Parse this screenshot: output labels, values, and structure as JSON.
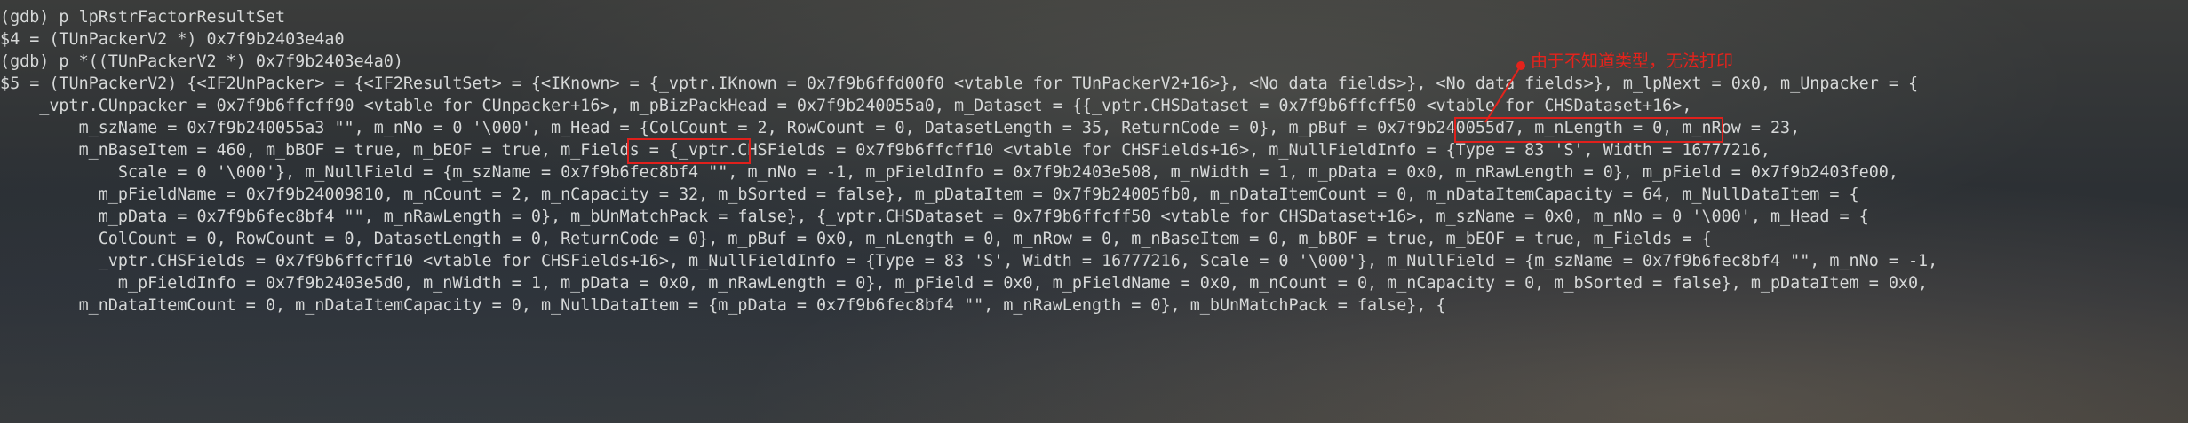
{
  "terminal": {
    "lines": [
      "(gdb) p lpRstrFactorResultSet",
      "$4 = (TUnPackerV2 *) 0x7f9b2403e4a0",
      "(gdb) p *((TUnPackerV2 *) 0x7f9b2403e4a0)",
      "$5 = (TUnPackerV2) {<IF2UnPacker> = {<IF2ResultSet> = {<IKnown> = {_vptr.IKnown = 0x7f9b6ffd00f0 <vtable for TUnPackerV2+16>}, <No data fields>}, <No data fields>}, m_lpNext = 0x0, m_Unpacker = {",
      "    _vptr.CUnpacker = 0x7f9b6ffcff90 <vtable for CUnpacker+16>, m_pBizPackHead = 0x7f9b240055a0, m_Dataset = {{_vptr.CHSDataset = 0x7f9b6ffcff50 <vtable for CHSDataset+16>,",
      "        m_szName = 0x7f9b240055a3 \"\", m_nNo = 0 '\\000', m_Head = {ColCount = 2, RowCount = 0, DatasetLength = 35, ReturnCode = 0}, m_pBuf = 0x7f9b240055d7, m_nLength = 0, m_nRow = 23,",
      "        m_nBaseItem = 460, m_bBOF = true, m_bEOF = true, m_Fields = {_vptr.CHSFields = 0x7f9b6ffcff10 <vtable for CHSFields+16>, m_NullFieldInfo = {Type = 83 'S', Width = 16777216,",
      "            Scale = 0 '\\000'}, m_NullField = {m_szName = 0x7f9b6fec8bf4 \"\", m_nNo = -1, m_pFieldInfo = 0x7f9b2403e508, m_nWidth = 1, m_pData = 0x0, m_nRawLength = 0}, m_pField = 0x7f9b2403fe00,",
      "          m_pFieldName = 0x7f9b24009810, m_nCount = 2, m_nCapacity = 32, m_bSorted = false}, m_pDataItem = 0x7f9b24005fb0, m_nDataItemCount = 0, m_nDataItemCapacity = 64, m_NullDataItem = {",
      "          m_pData = 0x7f9b6fec8bf4 \"\", m_nRawLength = 0}, m_bUnMatchPack = false}, {_vptr.CHSDataset = 0x7f9b6ffcff50 <vtable for CHSDataset+16>, m_szName = 0x0, m_nNo = 0 '\\000', m_Head = {",
      "          ColCount = 0, RowCount = 0, DatasetLength = 0, ReturnCode = 0}, m_pBuf = 0x0, m_nLength = 0, m_nRow = 0, m_nBaseItem = 0, m_bBOF = true, m_bEOF = true, m_Fields = {",
      "          _vptr.CHSFields = 0x7f9b6ffcff10 <vtable for CHSFields+16>, m_NullFieldInfo = {Type = 83 'S', Width = 16777216, Scale = 0 '\\000'}, m_NullField = {m_szName = 0x7f9b6fec8bf4 \"\", m_nNo = -1,",
      "            m_pFieldInfo = 0x7f9b2403e5d0, m_nWidth = 1, m_pData = 0x0, m_nRawLength = 0}, m_pField = 0x0, m_pFieldName = 0x0, m_nCount = 0, m_nCapacity = 0, m_bSorted = false}, m_pDataItem = 0x0,",
      "        m_nDataItemCount = 0, m_nDataItemCapacity = 0, m_NullDataItem = {m_pData = 0x7f9b6fec8bf4 \"\", m_nRawLength = 0}, m_bUnMatchPack = false}, {"
    ]
  },
  "annotation": {
    "text": "由于不知道类型，无法打印",
    "color": "#e3231c"
  },
  "highlights": [
    "m_pBuf = 0x7f9b240055d7",
    "m_Fields"
  ]
}
